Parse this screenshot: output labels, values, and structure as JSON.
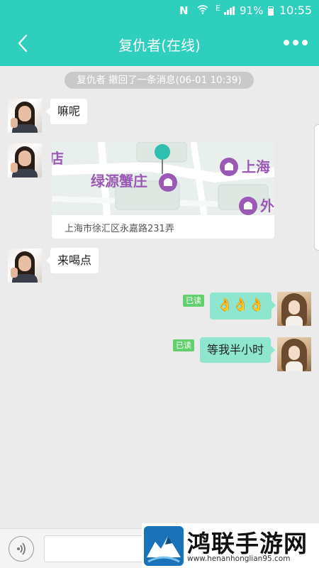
{
  "status_bar": {
    "nfc": "N",
    "battery": "91%",
    "time": "10:55"
  },
  "header": {
    "title": "复仇者(在线)"
  },
  "recall_notice": "复仇者 撤回了一条消息(06-01 10:39)",
  "messages": [
    {
      "side": "incoming",
      "text": "嘛呢"
    },
    {
      "side": "incoming",
      "type": "location",
      "map_labels": [
        "酒店",
        "绿源蟹庄",
        "上海",
        "外"
      ],
      "map_label_visible": [
        "店",
        "绿源蟹庄",
        "上海",
        "外"
      ],
      "address": "上海市徐汇区永嘉路231弄"
    },
    {
      "side": "incoming",
      "text": "来喝点"
    },
    {
      "side": "outgoing",
      "read": "已读",
      "text": "👌👌👌"
    },
    {
      "side": "outgoing",
      "read": "已读",
      "text": "等我半小时"
    }
  ],
  "input_bar": {
    "placeholder": "",
    "value": ""
  },
  "watermark": {
    "title": "鸿联手游网",
    "url": "www.henanhonglian95.com"
  },
  "colors": {
    "accent": "#2fcfbd",
    "outgoing_bubble": "#8ee6cf",
    "read_badge": "#63d06e",
    "map_poi": "#9b59b6"
  },
  "icons": [
    "back-arrow-icon",
    "more-icon",
    "voice-icon",
    "location-pin-icon",
    "poi-icon"
  ]
}
